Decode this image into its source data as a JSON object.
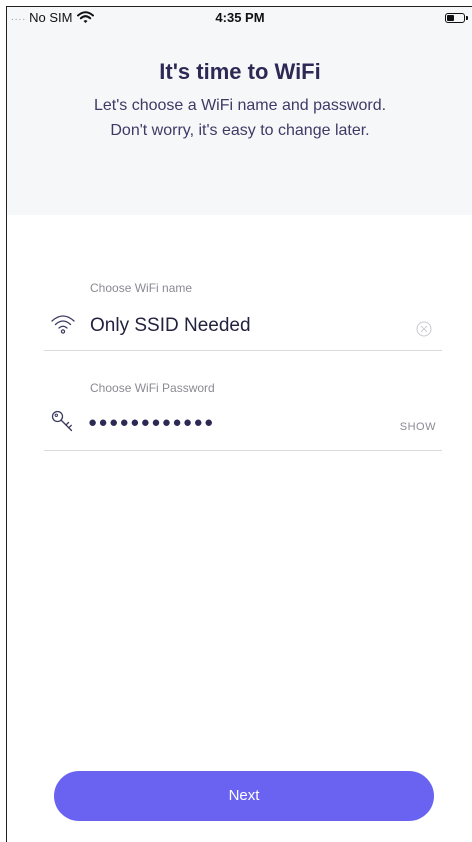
{
  "status_bar": {
    "signal": "....",
    "carrier": "No SIM",
    "time": "4:35 PM"
  },
  "header": {
    "title": "It's time to WiFi",
    "subtitle_line1": "Let's choose a WiFi name and password.",
    "subtitle_line2": "Don't worry, it's easy to change later."
  },
  "wifi_name_field": {
    "label": "Choose WiFi name",
    "value": "Only SSID Needed",
    "icon": "wifi-icon"
  },
  "wifi_password_field": {
    "label": "Choose WiFi Password",
    "value_masked": "●●●●●●●●●●●●",
    "toggle_label": "SHOW",
    "icon": "key-icon"
  },
  "next_button": {
    "label": "Next"
  },
  "colors": {
    "accent": "#6a63f2",
    "header_bg": "#f6f7f9",
    "title_text": "#2c2a55"
  }
}
